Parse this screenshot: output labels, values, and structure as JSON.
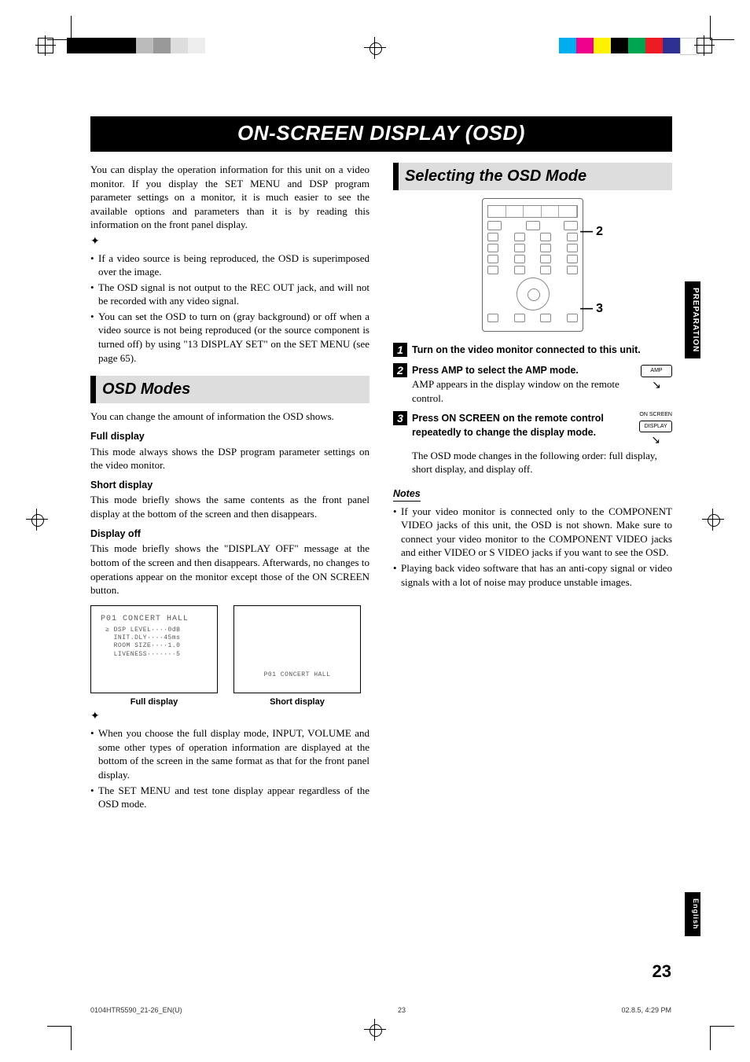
{
  "title": "ON-SCREEN DISPLAY (OSD)",
  "intro": "You can display the operation information for this unit on a video monitor. If you display the SET MENU and DSP program parameter settings on a monitor, it is much easier to see the available options and parameters than it is by reading this information on the front panel display.",
  "tips1": [
    "If a video source is being reproduced, the OSD is superimposed over the image.",
    "The OSD signal is not output to the REC OUT jack, and will not be recorded with any video signal.",
    "You can set the OSD to turn on (gray background) or off when a video source is not being reproduced (or the source component is turned off) by using \"13 DISPLAY SET\" on the SET MENU (see page 65)."
  ],
  "sec1_title": "OSD Modes",
  "sec1_intro": "You can change the amount of information the OSD shows.",
  "modes": [
    {
      "h": "Full display",
      "b": "This mode always shows the DSP program parameter settings on the video monitor."
    },
    {
      "h": "Short display",
      "b": "This mode briefly shows the same contents as the front panel display at the bottom of the screen and then disappears."
    },
    {
      "h": "Display off",
      "b": "This mode briefly shows the \"DISPLAY OFF\" message at the bottom of the screen and then disappears. Afterwards, no changes to operations appear on the monitor except those of the ON SCREEN button."
    }
  ],
  "full_disp": {
    "title": "P01 CONCERT HALL",
    "lines": "≥ DSP LEVEL····0dB\n  INIT.DLY····45ms\n  ROOM SIZE····1.0\n  LIVENESS·······5",
    "caption": "Full display"
  },
  "short_disp": {
    "line": "P01 CONCERT HALL",
    "caption": "Short display"
  },
  "tips2": [
    "When you choose the full display mode, INPUT, VOLUME and some other types of operation information are displayed at the bottom of the screen in the same format as that for the front panel display.",
    "The SET MENU and test tone display appear regardless of the OSD mode."
  ],
  "sec2_title": "Selecting the OSD Mode",
  "callouts": {
    "a": "2",
    "b": "3"
  },
  "steps": [
    {
      "n": "1",
      "bold": "Turn on the video monitor connected to this unit.",
      "body": "",
      "btn_label": "",
      "btn_text": ""
    },
    {
      "n": "2",
      "bold": "Press AMP to select the AMP mode.",
      "body": "AMP appears in the display window on the remote control.",
      "btn_label": "",
      "btn_text": "AMP"
    },
    {
      "n": "3",
      "bold": "Press ON SCREEN on the remote control repeatedly to change the display mode.",
      "body": "The OSD mode changes in the following order: full display, short display, and display off.",
      "btn_label": "ON SCREEN",
      "btn_text": "DISPLAY"
    }
  ],
  "notes_head": "Notes",
  "notes": [
    "If your video monitor is connected only to the COMPONENT VIDEO jacks of this unit, the OSD is not shown. Make sure to connect your video monitor to the COMPONENT VIDEO jacks and either VIDEO or S VIDEO jacks if you want to see the OSD.",
    "Playing back video software that has an anti-copy signal or video signals with a lot of noise may produce unstable images."
  ],
  "side_tabs": {
    "prep": "PREPARATION",
    "eng": "English"
  },
  "page_num": "23",
  "footer": {
    "left": "0104HTR5590_21-26_EN(U)",
    "mid": "23",
    "right": "02.8.5, 4:29 PM"
  }
}
